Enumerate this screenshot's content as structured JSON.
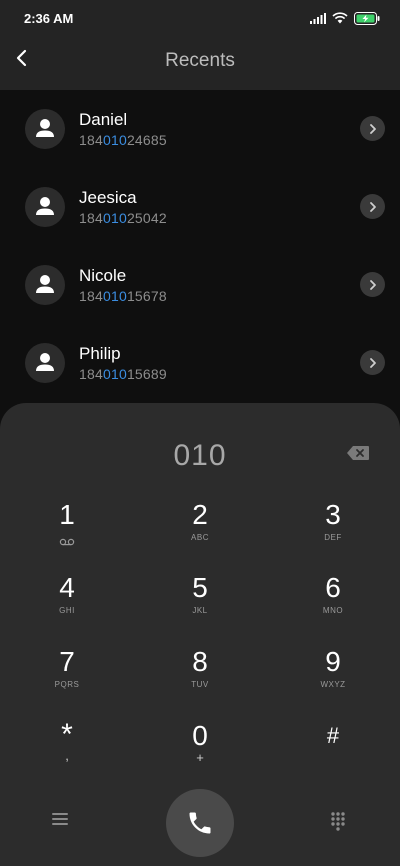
{
  "status_bar": {
    "time": "2:36 AM",
    "icons": [
      "signal-icon",
      "wifi-icon",
      "battery-charging-icon"
    ]
  },
  "header": {
    "title": "Recents",
    "back_icon": "back-arrow-icon"
  },
  "contacts": [
    {
      "name": "Daniel",
      "number_prefix": "184",
      "number_match": "010",
      "number_suffix": "24685"
    },
    {
      "name": "Jeesica",
      "number_prefix": "184",
      "number_match": "010",
      "number_suffix": "25042"
    },
    {
      "name": "Nicole",
      "number_prefix": "184",
      "number_match": "010",
      "number_suffix": "15678"
    },
    {
      "name": "Philip",
      "number_prefix": "184",
      "number_match": "010",
      "number_suffix": "15689"
    }
  ],
  "dialpad": {
    "display": "010",
    "keys": [
      {
        "digit": "1",
        "sub": ""
      },
      {
        "digit": "2",
        "sub": "ABC"
      },
      {
        "digit": "3",
        "sub": "DEF"
      },
      {
        "digit": "4",
        "sub": "GHI"
      },
      {
        "digit": "5",
        "sub": "JKL"
      },
      {
        "digit": "6",
        "sub": "MNO"
      },
      {
        "digit": "7",
        "sub": "PQRS"
      },
      {
        "digit": "8",
        "sub": "TUV"
      },
      {
        "digit": "9",
        "sub": "WXYZ"
      },
      {
        "digit": "*",
        "sub": ","
      },
      {
        "digit": "0",
        "sub": "+"
      },
      {
        "digit": "#",
        "sub": ""
      }
    ]
  },
  "colors": {
    "highlight": "#3b8de0",
    "panel": "#2c2c2c",
    "header": "#242424",
    "list_bg": "#0f0f0f"
  }
}
